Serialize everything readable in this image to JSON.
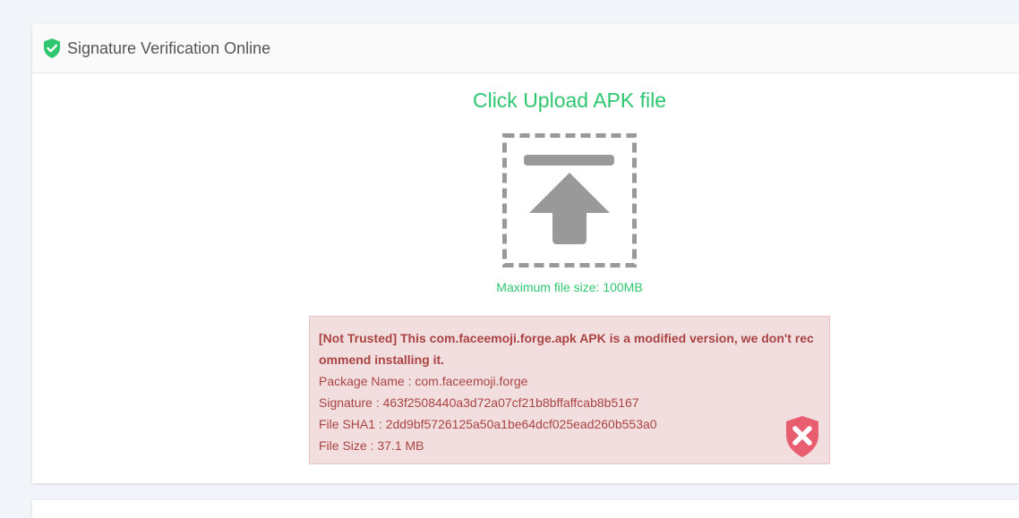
{
  "header": {
    "title": "Signature Verification Online",
    "icon": "verified-shield-icon",
    "icon_color": "#2ec76f"
  },
  "upload": {
    "title": "Click Upload APK file",
    "icon": "upload-arrow-icon",
    "max_size": "Maximum file size: 100MB",
    "accent_color": "#2ec76f"
  },
  "result": {
    "status": "not-trusted",
    "headline": "[Not Trusted] This com.faceemoji.forge.apk APK is a modified version, we don't recommend installing it.",
    "package_name": "Package Name : com.faceemoji.forge",
    "signature": "Signature : 463f2508440a3d72a07cf21b8bffaffcab8b5167",
    "file_sha1": "File SHA1 : 2dd9bf5726125a50a1be64dcf025ead260b553a0",
    "file_size": "File Size : 37.1 MB",
    "icon": "shield-x-icon",
    "alert_text_color": "#a94442",
    "alert_bg_color": "#f2dedf",
    "icon_color": "#e85d6f"
  }
}
